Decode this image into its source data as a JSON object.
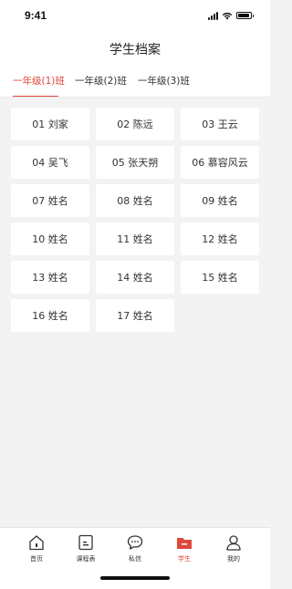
{
  "status_bar": {
    "time": "9:41",
    "signal_icon": "signal-bars-icon",
    "wifi_icon": "wifi-icon",
    "battery_icon": "battery-icon"
  },
  "header": {
    "title": "学生档案"
  },
  "tabs": [
    {
      "label": "一年级(1)班",
      "active": true
    },
    {
      "label": "一年级(2)班",
      "active": false
    },
    {
      "label": "一年级(3)班",
      "active": false
    }
  ],
  "students": [
    "01 刘家",
    "02 陈远",
    "03 王云",
    "04 吴飞",
    "05 张天朔",
    "06 慕容风云",
    "07 姓名",
    "08 姓名",
    "09 姓名",
    "10 姓名",
    "11 姓名",
    "12 姓名",
    "13 姓名",
    "14 姓名",
    "15 姓名",
    "16 姓名",
    "17 姓名"
  ],
  "tabbar": {
    "items": [
      {
        "label": "首页",
        "icon": "home-icon",
        "active": false
      },
      {
        "label": "课程表",
        "icon": "schedule-icon",
        "active": false
      },
      {
        "label": "私信",
        "icon": "message-icon",
        "active": false
      },
      {
        "label": "学生",
        "icon": "folder-icon",
        "active": true
      },
      {
        "label": "我的",
        "icon": "profile-icon",
        "active": false
      }
    ]
  },
  "colors": {
    "accent": "#e0483b",
    "background": "#f3f3f3",
    "card": "#ffffff"
  }
}
